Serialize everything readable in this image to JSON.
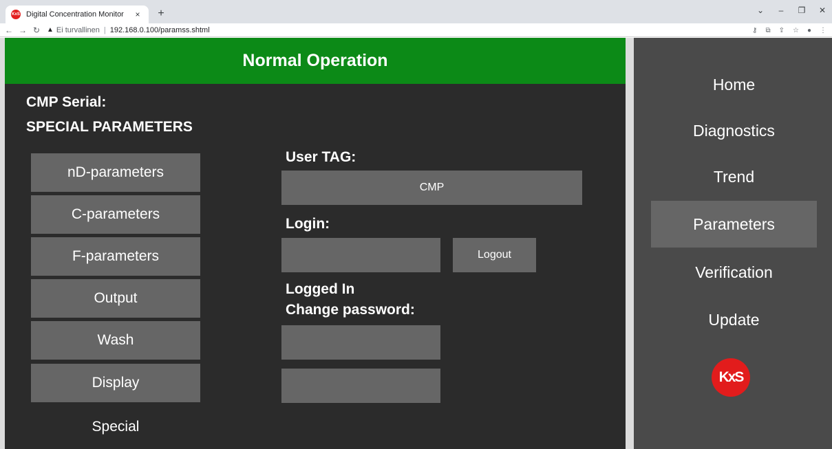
{
  "browser": {
    "tab_title": "Digital Concentration Monitor",
    "tab_close": "×",
    "new_tab": "+",
    "url_warning": "Ei turvallinen",
    "url": "192.168.0.100/paramss.shtml",
    "win_controls": [
      "⌄",
      "–",
      "❐",
      "✕"
    ],
    "favicon_text": "KxS"
  },
  "status": {
    "banner": "Normal Operation",
    "color": "#0c8a17"
  },
  "header": {
    "serial_label": "CMP Serial:",
    "section_title": "SPECIAL PARAMETERS"
  },
  "param_menu": {
    "items": [
      "nD-parameters",
      "C-parameters",
      "F-parameters",
      "Output",
      "Wash",
      "Display"
    ],
    "current": "Special"
  },
  "form": {
    "user_tag_label": "User TAG:",
    "user_tag_value": "CMP",
    "login_label": "Login:",
    "login_value": "",
    "logout_label": "Logout",
    "logged_in_text": "Logged In",
    "change_password_label": "Change password:",
    "new_password_value": "",
    "confirm_password_value": ""
  },
  "sidebar": {
    "items": [
      "Home",
      "Diagnostics",
      "Trend",
      "Parameters",
      "Verification",
      "Update"
    ],
    "active": "Parameters",
    "logo_text": "KxS",
    "logo_color": "#e21c1c"
  }
}
